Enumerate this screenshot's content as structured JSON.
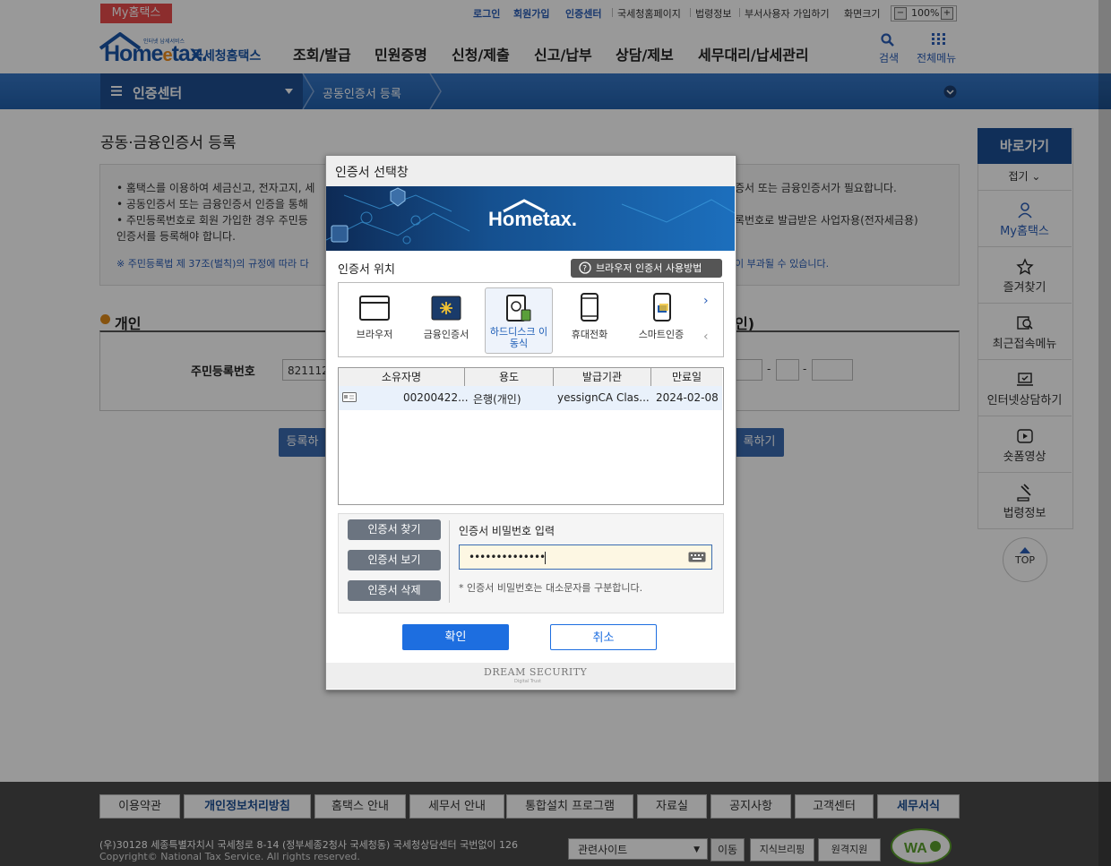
{
  "top_util": {
    "my_tab": "My홈택스",
    "login": "로그인",
    "join": "회원가입",
    "cert_center": "인증센터",
    "nts_page": "국세청홈페이지",
    "law_info": "법령정보",
    "dept_join": "부서사용자 가입하기",
    "screen_size": "화면크기",
    "zoom": "100%"
  },
  "header": {
    "logo_text": "Home",
    "logo_e": "e",
    "logo_tax": "tax.",
    "logo_sub": "국세청홈택스",
    "logo_tiny": "인터넷 납세서비스",
    "nav": [
      "조회/발급",
      "민원증명",
      "신청/제출",
      "신고/납부",
      "상담/제보",
      "세무대리/납세관리"
    ],
    "search": "검색",
    "all_menu": "전체메뉴"
  },
  "navbar": {
    "title": "인증센터",
    "crumb": "공동인증서 등록"
  },
  "page": {
    "title": "공동·금융인증서 등록",
    "info_lines": [
      "• 홈택스를 이용하여 세금신고, 전자고지, 세",
      "• 공동인증서 또는 금융인증서 인증을 통해",
      "• 주민등록번호로 회원 가입한 경우 주민등",
      "  인증서를 등록해야 합니다."
    ],
    "info_right_1": "증서 또는 금융인증서가 필요합니다.",
    "info_right_2": "록번호로 발급받은 사업자용(전자세금용)",
    "info_note": "※ 주민등록법 제 37조(벌칙)의 규정에 따라 다",
    "info_note_right": "이 부과될 수 있습니다.",
    "section_personal": "개인",
    "section_right": "인)",
    "rrn_label": "주민등록번호",
    "rrn_value": "821112",
    "btn_left": "등록하",
    "btn_right": "록하기"
  },
  "quick": {
    "title": "바로가기",
    "fold": "접기",
    "items": [
      "My홈택스",
      "즐겨찾기",
      "최근접속메뉴",
      "인터넷상담하기",
      "숏폼영상",
      "법령정보"
    ],
    "top": "TOP"
  },
  "footer": {
    "links": [
      "이용약관",
      "개인정보처리방침",
      "홈택스 안내",
      "세무서 안내",
      "통합설치 프로그램",
      "자료실",
      "공지사항",
      "고객센터",
      "세무서식"
    ],
    "address": "(우)30128 세종특별자치시 국세청로 8-14 (정부세종2청사 국세청동) 국세청상담센터 국번없이 126",
    "copyright": "Copyright© National Tax Service. All rights reserved.",
    "related_site": "관련사이트",
    "go": "이동",
    "badge1": "지식브리핑",
    "badge2": "원격지원"
  },
  "dialog": {
    "title": "인증서 선택창",
    "banner_logo": "Hometax.",
    "location_label": "인증서 위치",
    "help_btn": "브라우저 인증서 사용방법",
    "locations": [
      "브라우저",
      "금융인증서",
      "하드디스크 이동식",
      "휴대전화",
      "스마트인증"
    ],
    "selected_location": "하드디스크 이동식",
    "table_headers": [
      "소유자명",
      "용도",
      "발급기관",
      "만료일"
    ],
    "rows": [
      {
        "owner": "00200422...",
        "usage": "은행(개인)",
        "issuer": "yessignCA Clas...",
        "expires": "2024-02-08"
      }
    ],
    "find_btn": "인증서 찾기",
    "view_btn": "인증서 보기",
    "delete_btn": "인증서 삭제",
    "pw_label": "인증서 비밀번호 입력",
    "pw_value": "••••••••••••••",
    "pw_note": "* 인증서 비밀번호는 대소문자를 구분합니다.",
    "ok": "확인",
    "cancel": "취소",
    "vendor": "DREAM SECURITY",
    "vendor_sub": "Digital Trust"
  }
}
